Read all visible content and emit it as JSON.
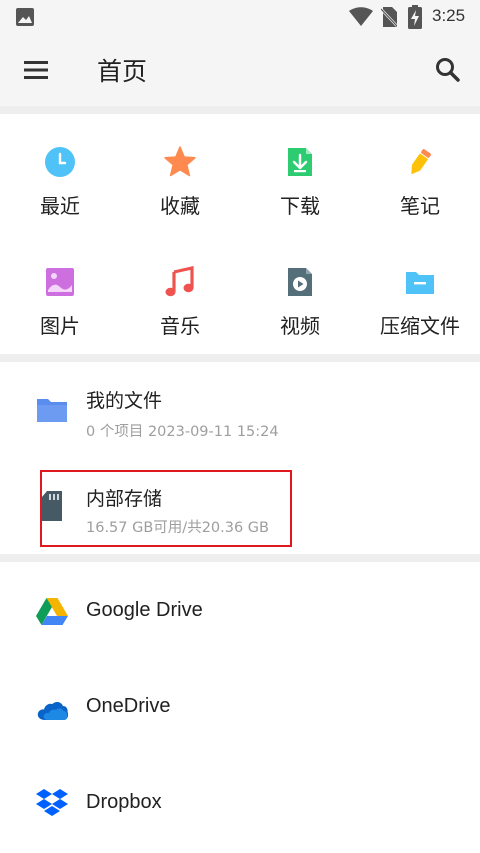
{
  "status_bar": {
    "time": "3:25",
    "icons": [
      "image-icon",
      "wifi-icon",
      "no-sim-icon",
      "battery-charging-icon"
    ]
  },
  "app_bar": {
    "title": "首页",
    "menu_icon": "menu-icon",
    "search_icon": "search-icon"
  },
  "shortcuts": [
    {
      "label": "最近",
      "icon": "clock-icon",
      "color": "#4fc3f7"
    },
    {
      "label": "收藏",
      "icon": "star-icon",
      "color": "#ff8a50"
    },
    {
      "label": "下载",
      "icon": "download-icon",
      "color": "#2ecc71"
    },
    {
      "label": "笔记",
      "icon": "pencil-icon",
      "color": "#ffc107"
    },
    {
      "label": "图片",
      "icon": "picture-icon",
      "color": "#ce6fe0"
    },
    {
      "label": "音乐",
      "icon": "music-icon",
      "color": "#ef5350"
    },
    {
      "label": "视频",
      "icon": "video-icon",
      "color": "#546e7a"
    },
    {
      "label": "压缩文件",
      "icon": "zip-folder-icon",
      "color": "#4fc3f7"
    }
  ],
  "locations": [
    {
      "title": "我的文件",
      "subtitle": "0 个项目 2023-09-11 15:24",
      "icon": "folder-icon",
      "color": "#5b8def"
    },
    {
      "title": "内部存储",
      "subtitle": "16.57 GB可用/共20.36 GB",
      "icon": "sd-card-icon",
      "color": "#455a64",
      "highlighted": true
    }
  ],
  "cloud_services": [
    {
      "title": "Google Drive",
      "icon": "google-drive-icon"
    },
    {
      "title": "OneDrive",
      "icon": "onedrive-icon"
    },
    {
      "title": "Dropbox",
      "icon": "dropbox-icon"
    }
  ],
  "colors": {
    "background": "#ffffff",
    "app_bar": "#f5f5f5",
    "divider": "#eeeeee",
    "highlight_box": "#e0181f"
  }
}
